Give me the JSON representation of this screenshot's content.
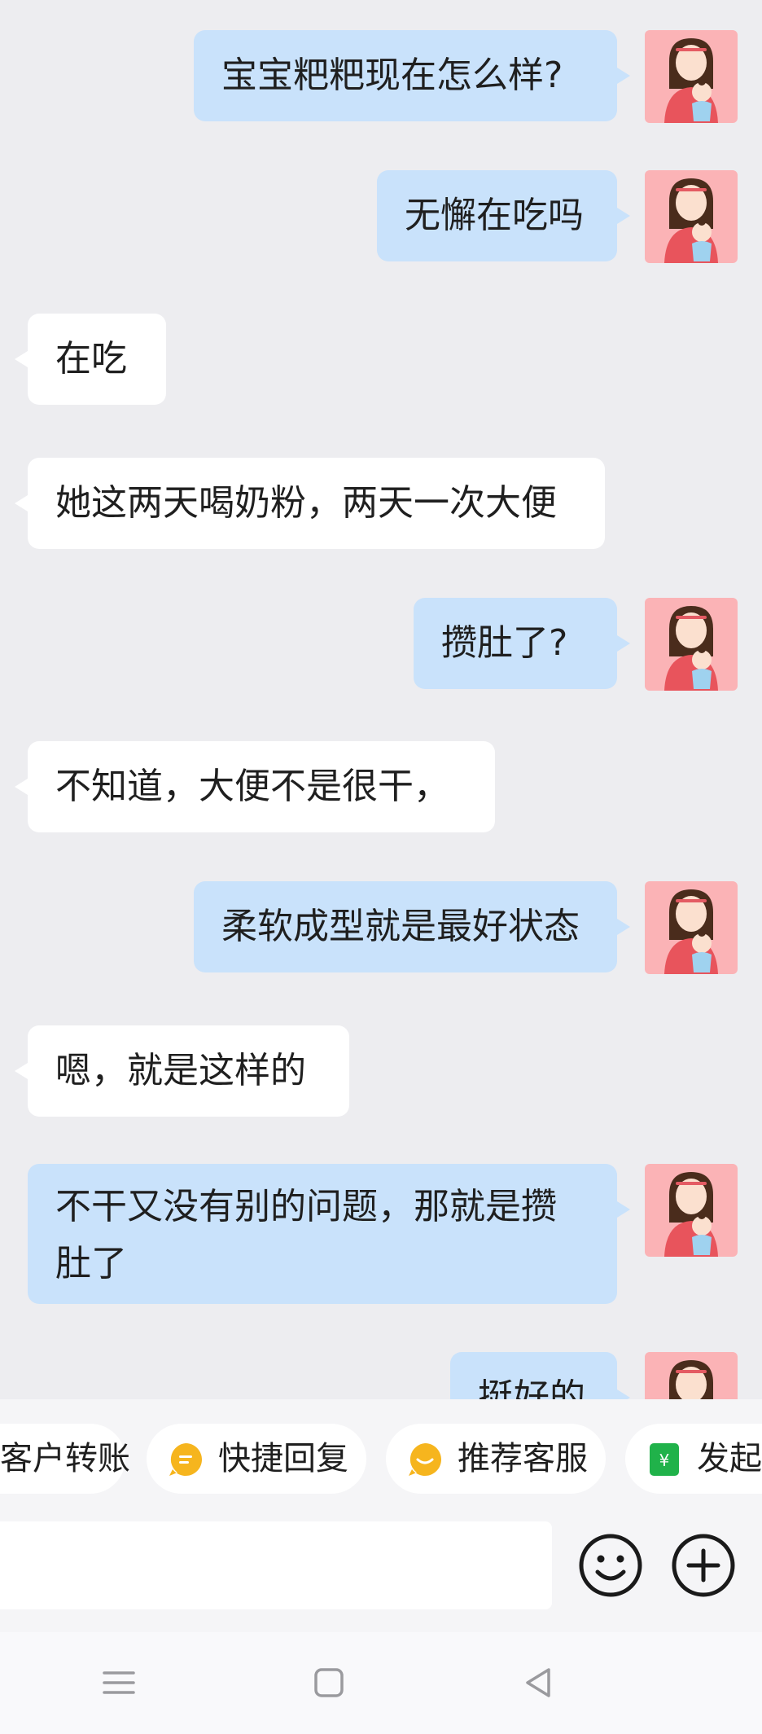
{
  "messages": [
    {
      "side": "out",
      "text": "宝宝粑粑现在怎么样?"
    },
    {
      "side": "out",
      "text": "无懈在吃吗"
    },
    {
      "side": "in",
      "text": "在吃"
    },
    {
      "side": "in",
      "text": "她这两天喝奶粉，两天一次大便"
    },
    {
      "side": "out",
      "text": "攒肚了?"
    },
    {
      "side": "in",
      "text": "不知道，大便不是很干，"
    },
    {
      "side": "out",
      "text": "柔软成型就是最好状态"
    },
    {
      "side": "in",
      "text": "嗯，就是这样的"
    },
    {
      "side": "out",
      "text": "不干又没有别的问题，那就是攒肚了"
    },
    {
      "side": "out",
      "text": "挺好的"
    }
  ],
  "quick_actions": [
    {
      "label": "客户转账",
      "icon": "transfer-icon"
    },
    {
      "label": "快捷回复",
      "icon": "quick-reply-icon"
    },
    {
      "label": "推荐客服",
      "icon": "recommend-service-icon"
    },
    {
      "label": "发起",
      "icon": "payment-icon"
    }
  ],
  "input": {
    "value": "",
    "emoji_icon": "emoji-icon",
    "plus_icon": "plus-icon"
  },
  "nav": {
    "menu_icon": "menu-icon",
    "home_icon": "home-icon",
    "back_icon": "back-icon"
  },
  "colors": {
    "outgoing_bubble": "#c9e2fb",
    "incoming_bubble": "#ffffff",
    "background": "#ededf0",
    "avatar_bg": "#fbb3b6",
    "chip_orange": "#f6b51e",
    "chip_green": "#20b24a"
  }
}
